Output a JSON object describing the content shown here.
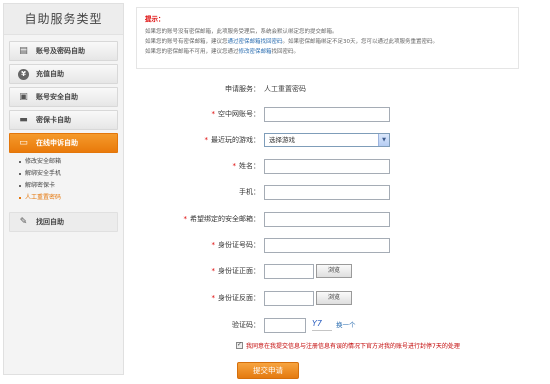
{
  "sidebar": {
    "title": "自助服务类型",
    "items": [
      {
        "label": "账号及密码自助",
        "icon": "id-card-icon"
      },
      {
        "label": "充值自助",
        "icon": "yen-icon"
      },
      {
        "label": "账号安全自助",
        "icon": "lock-icon"
      },
      {
        "label": "密保卡自助",
        "icon": "card-icon"
      },
      {
        "label": "在线申诉自助",
        "icon": "monitor-icon"
      }
    ],
    "subitems": [
      "修改安全邮箱",
      "解绑安全手机",
      "解绑密保卡",
      "人工重置密码"
    ],
    "last": {
      "label": "找回自助",
      "icon": "wrench-icon"
    }
  },
  "notice": {
    "title": "提示：",
    "line1": "如果您的账号没有密保邮箱，此项服务受理后，系统会默认绑定您的提交邮箱。",
    "line2_a": "如果您的账号有密保邮箱，建议您",
    "line2_link": "通过密保邮箱找回密码",
    "line2_b": "。如果密保邮箱绑定不足30天，您可以通过此项服务重置密码。",
    "line3_a": "如果您的密保邮箱不可用，建议您通过",
    "line3_link": "修改密保邮箱",
    "line3_b": "找回密码。"
  },
  "form": {
    "service_label": "申请服务：",
    "service_value": "人工重置密码",
    "account_label": "空中网账号：",
    "game_label": "最近玩的游戏：",
    "game_value": "选择游戏",
    "name_label": "姓名：",
    "phone_label": "手机：",
    "email_label": "希望绑定的安全邮箱：",
    "idno_label": "身份证号码：",
    "idfront_label": "身份证正面：",
    "idback_label": "身份证反面：",
    "browse_label": "浏览",
    "captcha_label": "验证码：",
    "captcha_text": "Y7",
    "swap_label": "换一个",
    "agree_text": "我同意在我提交信息与注册信息有误的情况下官方对我的账号进行封停7天的处理",
    "submit_label": "提交申请"
  }
}
